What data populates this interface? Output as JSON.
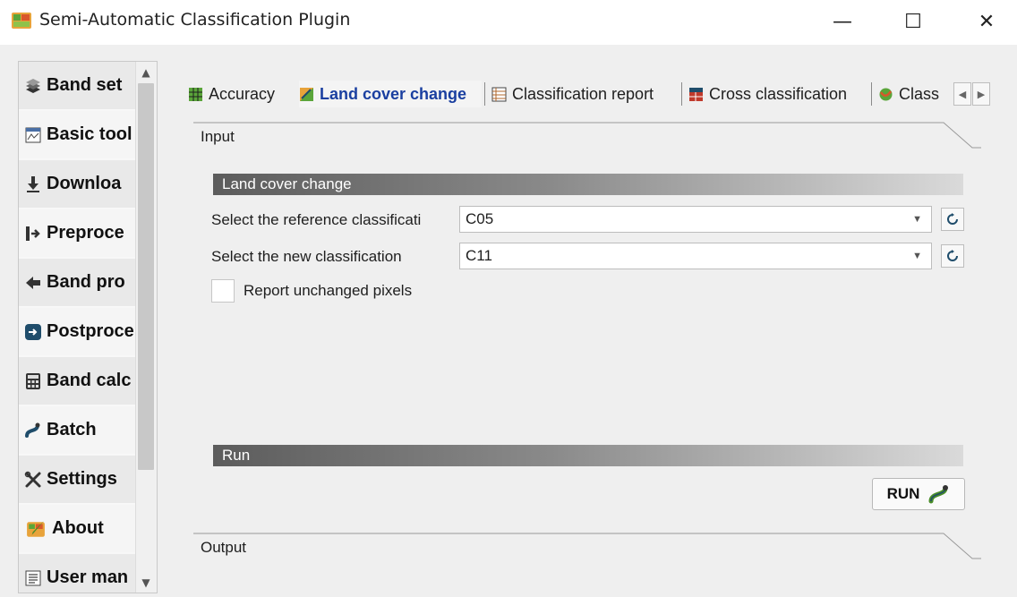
{
  "window": {
    "title": "Semi-Automatic Classification Plugin",
    "minimize": "—",
    "maximize": "☐",
    "close": "✕"
  },
  "sidebar": {
    "items": [
      {
        "label": "Band set",
        "icon": "band-set-icon"
      },
      {
        "label": "Basic tool",
        "icon": "basic-tools-icon"
      },
      {
        "label": "Downloa",
        "icon": "download-icon"
      },
      {
        "label": "Preproce",
        "icon": "preprocessing-icon"
      },
      {
        "label": "Band pro",
        "icon": "band-processing-icon"
      },
      {
        "label": "Postproce",
        "icon": "postprocessing-icon"
      },
      {
        "label": "Band calc",
        "icon": "band-calc-icon"
      },
      {
        "label": "Batch",
        "icon": "batch-icon"
      },
      {
        "label": "Settings",
        "icon": "settings-icon"
      },
      {
        "label": "About",
        "icon": "about-icon"
      },
      {
        "label": "User man",
        "icon": "user-manual-icon"
      }
    ],
    "scroll_up": "▲",
    "scroll_down": "▼"
  },
  "tabs": [
    {
      "label": "Accuracy",
      "active": false
    },
    {
      "label": "Land cover change",
      "active": true
    },
    {
      "label": "Classification report",
      "active": false
    },
    {
      "label": "Cross classification",
      "active": false
    },
    {
      "label": "Class",
      "active": false
    }
  ],
  "tab_scroll": {
    "left": "◀",
    "right": "▶"
  },
  "input_group": {
    "label": "Input"
  },
  "land_cover_change": {
    "title": "Land cover change",
    "reference_label": "Select the reference classificati",
    "reference_value": "C05",
    "new_label": "Select the new classification",
    "new_value": "C11",
    "dropdown_arrow": "▼",
    "report_unchanged_label": "Report unchanged pixels",
    "report_unchanged_checked": false
  },
  "run_section": {
    "title": "Run",
    "run_label": "RUN"
  },
  "output_group": {
    "label": "Output"
  },
  "colors": {
    "active_tab_text": "#1a3fa0",
    "section_bar_dark": "#5c5c5c",
    "section_bar_light": "#dadada",
    "window_bg": "#efefef"
  }
}
